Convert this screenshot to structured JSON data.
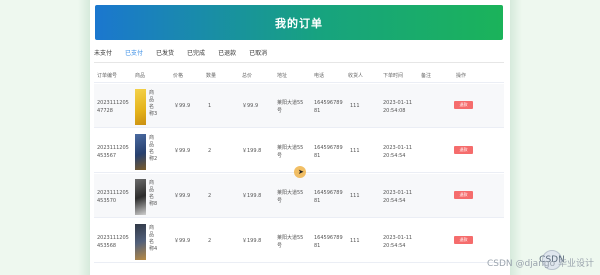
{
  "header": {
    "title": "我的订单"
  },
  "tabs": [
    {
      "label": "未支付"
    },
    {
      "label": "已支付"
    },
    {
      "label": "已发货"
    },
    {
      "label": "已完成"
    },
    {
      "label": "已退款"
    },
    {
      "label": "已取消"
    }
  ],
  "active_tab": "已支付",
  "columns": {
    "order_no": "订单编号",
    "goods": "商品",
    "price": "价格",
    "qty": "数量",
    "total": "总价",
    "address": "地址",
    "phone": "电话",
    "receiver": "收货人",
    "order_time": "下单时间",
    "remark": "备注",
    "action": "操作"
  },
  "rows": [
    {
      "order_no_1": "2023111205",
      "order_no_2": "47728",
      "goods_1": "商",
      "goods_2": "品",
      "goods_3": "名",
      "goods_4": "称3",
      "price": "￥99.9",
      "qty": "1",
      "total": "￥99.9",
      "addr_1": "莱阳大道55",
      "addr_2": "号",
      "phone_1": "164596789",
      "phone_2": "81",
      "receiver": "111",
      "date": "2023-01-11",
      "time": "20:54:08",
      "action": "退款"
    },
    {
      "order_no_1": "2023111205",
      "order_no_2": "453567",
      "goods_1": "商",
      "goods_2": "品",
      "goods_3": "名",
      "goods_4": "称2",
      "price": "￥99.9",
      "qty": "2",
      "total": "￥199.8",
      "addr_1": "莱阳大道55",
      "addr_2": "号",
      "phone_1": "164596789",
      "phone_2": "81",
      "receiver": "111",
      "date": "2023-01-11",
      "time": "20:54:54",
      "action": "退款"
    },
    {
      "order_no_1": "2023111205",
      "order_no_2": "453570",
      "goods_1": "商",
      "goods_2": "品",
      "goods_3": "名",
      "goods_4": "称8",
      "price": "￥99.9",
      "qty": "2",
      "total": "￥199.8",
      "addr_1": "莱阳大道55",
      "addr_2": "号",
      "phone_1": "164596789",
      "phone_2": "81",
      "receiver": "111",
      "date": "2023-01-11",
      "time": "20:54:54",
      "action": "退款"
    },
    {
      "order_no_1": "2023111205",
      "order_no_2": "453568",
      "goods_1": "商",
      "goods_2": "品",
      "goods_3": "名",
      "goods_4": "称4",
      "price": "￥99.9",
      "qty": "2",
      "total": "￥199.8",
      "addr_1": "莱阳大道55",
      "addr_2": "号",
      "phone_1": "164596789",
      "phone_2": "81",
      "receiver": "111",
      "date": "2023-01-11",
      "time": "20:54:54",
      "action": "退款"
    }
  ],
  "watermark": {
    "text": "CSDN @django 毕业设计",
    "logo": "CSDN"
  },
  "colors": {
    "banner_start": "#1b77cf",
    "banner_end": "#1bb35a",
    "active_tab": "#3a8ee6",
    "refund_button": "#f56c6c",
    "page_background": "#eef8ef"
  }
}
